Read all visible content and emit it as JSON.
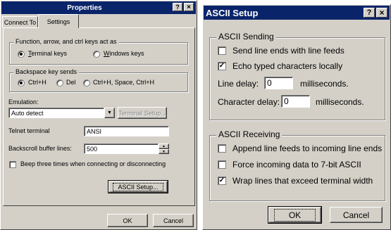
{
  "properties": {
    "title": "Properties",
    "help_label": "?",
    "close_label": "×",
    "tabs": [
      "Connect To",
      "Settings"
    ],
    "keys_group": {
      "label": "Function, arrow, and ctrl keys act as",
      "options": [
        {
          "label": "Terminal keys",
          "mnemonic": "T",
          "rest": "erminal keys",
          "selected": true
        },
        {
          "label": "Windows keys",
          "mnemonic": "W",
          "rest": "indows keys",
          "selected": false
        }
      ]
    },
    "backspace_group": {
      "label": "Backspace key sends",
      "options": [
        {
          "label": "Ctrl+H",
          "selected": true
        },
        {
          "label": "Del",
          "selected": false
        },
        {
          "label": "Ctrl+H, Space, Ctrl+H",
          "selected": false
        }
      ]
    },
    "emulation_label": "Emulation:",
    "emulation_value": "Auto detect",
    "terminal_setup_label": "Terminal Setup...",
    "telnet_label": "Telnet terminal",
    "telnet_value": "ANSI",
    "backscroll_label": "Backscroll buffer lines:",
    "backscroll_value": "500",
    "beep_label": "Beep three times when connecting or disconnecting",
    "beep_checked": false,
    "ascii_setup_label": "ASCII Setup...",
    "ok_label": "OK",
    "cancel_label": "Cancel"
  },
  "ascii": {
    "title": "ASCII Setup",
    "help_label": "?",
    "close_label": "×",
    "sending": {
      "label": "ASCII Sending",
      "send_line_ends": {
        "label": "Send line ends with line feeds",
        "checked": false
      },
      "echo": {
        "label": "Echo typed characters locally",
        "checked": true
      },
      "line_delay_label": "Line delay:",
      "line_delay_value": "0",
      "line_delay_unit": "milliseconds.",
      "char_delay_label": "Character delay:",
      "char_delay_value": "0",
      "char_delay_unit": "milliseconds."
    },
    "receiving": {
      "label": "ASCII Receiving",
      "append": {
        "label": "Append line feeds to incoming line ends",
        "checked": false
      },
      "force7bit": {
        "label": "Force incoming data to 7-bit ASCII",
        "checked": false
      },
      "wrap": {
        "label": "Wrap lines that exceed terminal width",
        "checked": true
      }
    },
    "ok_label": "OK",
    "cancel_label": "Cancel"
  }
}
